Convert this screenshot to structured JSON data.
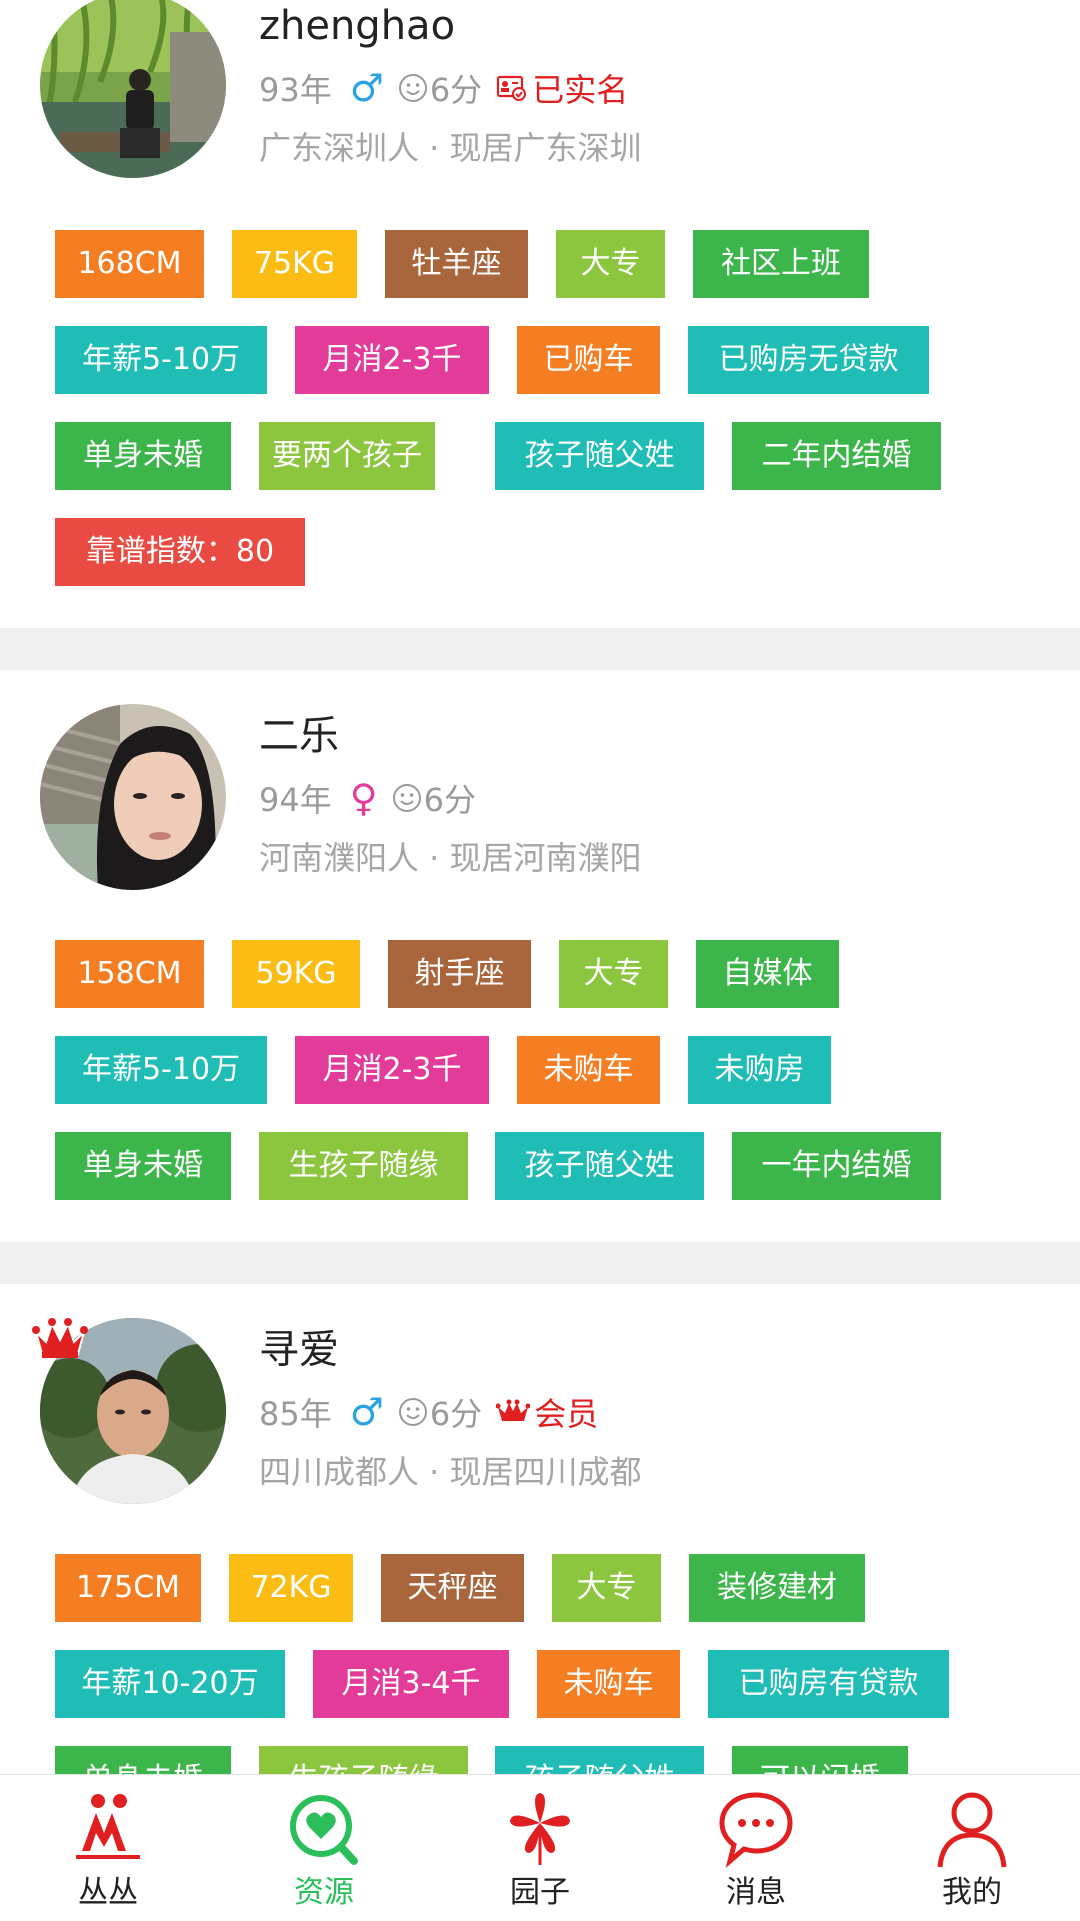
{
  "colors": {
    "orange": "#f57e22",
    "yellow": "#fbbd14",
    "brown": "#a9663d",
    "lime": "#8cc63f",
    "green": "#3cb54a",
    "teal": "#1fbdb5",
    "pink": "#e23b9a",
    "red": "#e94b42",
    "male": "#2ba3e3",
    "female": "#e33b9b",
    "accent_red": "#e02020",
    "active_tab": "#2bbf5c"
  },
  "profiles": [
    {
      "name": "zhenghao",
      "year": "93年",
      "gender_symbol": "♂",
      "gender": "male",
      "score": "6分",
      "verify_label": "已实名",
      "location": "广东深圳人 · 现居广东深圳",
      "tags": [
        "168CM",
        "75KG",
        "牡羊座",
        "大专",
        "社区上班",
        "年薪5-10万",
        "月消2-3千",
        "已购车",
        "已购房无贷款",
        "单身未婚",
        "要两个孩子",
        "孩子随父姓",
        "二年内结婚",
        "靠谱指数：80"
      ]
    },
    {
      "name": "二乐",
      "year": "94年",
      "gender_symbol": "♀",
      "gender": "female",
      "score": "6分",
      "location": "河南濮阳人 · 现居河南濮阳",
      "tags": [
        "158CM",
        "59KG",
        "射手座",
        "大专",
        "自媒体",
        "年薪5-10万",
        "月消2-3千",
        "未购车",
        "未购房",
        "单身未婚",
        "生孩子随缘",
        "孩子随父姓",
        "一年内结婚"
      ]
    },
    {
      "name": "寻爱",
      "year": "85年",
      "gender_symbol": "♂",
      "gender": "male",
      "score": "6分",
      "member_label": "会员",
      "location": "四川成都人 · 现居四川成都",
      "tags": [
        "175CM",
        "72KG",
        "天秤座",
        "大专",
        "装修建材",
        "年薪10-20万",
        "月消3-4千",
        "未购车",
        "已购房有贷款",
        "单身未婚",
        "生孩子随缘",
        "孩子随父姓",
        "可以闪婚"
      ]
    }
  ],
  "tabbar": [
    {
      "label": "丛丛",
      "icon": "couple-icon"
    },
    {
      "label": "资源",
      "icon": "heart-search-icon",
      "active": true
    },
    {
      "label": "园子",
      "icon": "flower-icon"
    },
    {
      "label": "消息",
      "icon": "chat-bubble-icon"
    },
    {
      "label": "我的",
      "icon": "person-icon"
    }
  ]
}
